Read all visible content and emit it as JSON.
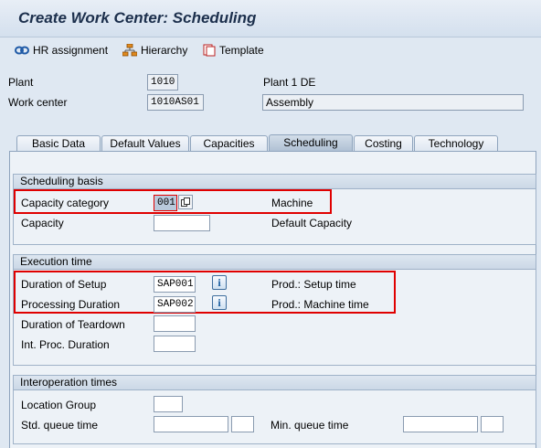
{
  "window": {
    "title": "Create Work Center: Scheduling"
  },
  "toolbar": {
    "hr_assignment": "HR assignment",
    "hierarchy": "Hierarchy",
    "template": "Template"
  },
  "header": {
    "plant_label": "Plant",
    "plant_value": "1010",
    "plant_desc": "Plant 1 DE",
    "workcenter_label": "Work center",
    "workcenter_value": "1010AS01",
    "workcenter_desc": "Assembly"
  },
  "tabs": [
    {
      "label": "Basic Data"
    },
    {
      "label": "Default Values"
    },
    {
      "label": "Capacities"
    },
    {
      "label": "Scheduling",
      "active": true
    },
    {
      "label": "Costing"
    },
    {
      "label": "Technology"
    }
  ],
  "scheduling_basis": {
    "heading": "Scheduling basis",
    "capacity_category_label": "Capacity category",
    "capacity_category_value": "001",
    "capacity_category_desc": "Machine",
    "capacity_label": "Capacity",
    "capacity_value": "",
    "capacity_desc": "Default Capacity"
  },
  "execution_time": {
    "heading": "Execution time",
    "setup_label": "Duration of Setup",
    "setup_value": "SAP001",
    "setup_desc": "Prod.: Setup time",
    "processing_label": "Processing Duration",
    "processing_value": "SAP002",
    "processing_desc": "Prod.: Machine time",
    "teardown_label": "Duration of Teardown",
    "teardown_value": "",
    "int_proc_label": "Int. Proc. Duration",
    "int_proc_value": ""
  },
  "interoperation": {
    "heading": "Interoperation times",
    "location_group_label": "Location Group",
    "location_group_value": "",
    "std_queue_label": "Std. queue time",
    "min_queue_label": "Min. queue time"
  },
  "icons": {
    "hr_assignment": "hr-assignment-icon",
    "hierarchy": "hierarchy-icon",
    "template": "template-icon",
    "info": "info-icon",
    "copy": "copy-icon"
  },
  "colors": {
    "highlight_box": "#e00000",
    "title": "#1c2f4c"
  }
}
